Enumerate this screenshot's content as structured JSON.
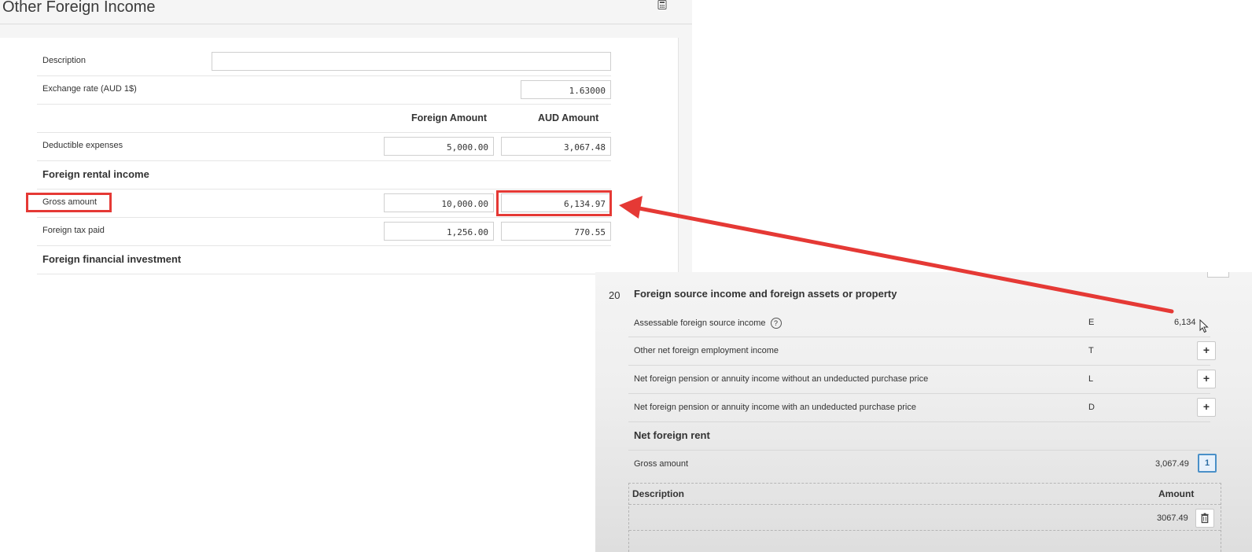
{
  "left_form": {
    "title": "Other Foreign Income",
    "calculator_icon": "calculator-icon",
    "description": {
      "label": "Description",
      "value": ""
    },
    "exchange_rate": {
      "label": "Exchange rate (AUD 1$)",
      "value": "1.63000"
    },
    "columns": {
      "foreign": "Foreign Amount",
      "aud": "AUD Amount"
    },
    "deductible_expenses": {
      "label": "Deductible expenses",
      "foreign": "5,000.00",
      "aud": "3,067.48"
    },
    "rental_section": "Foreign rental income",
    "gross_amount": {
      "label": "Gross amount",
      "foreign": "10,000.00",
      "aud": "6,134.97"
    },
    "foreign_tax_paid": {
      "label": "Foreign tax paid",
      "foreign": "1,256.00",
      "aud": "770.55"
    },
    "investment_section": "Foreign financial investment"
  },
  "right_form": {
    "question_number": "20",
    "question_title": "Foreign source income and foreign assets or property",
    "rows": [
      {
        "label": "Assessable foreign source income",
        "code": "E",
        "value": "6,134"
      },
      {
        "label": "Other net foreign employment income",
        "code": "T"
      },
      {
        "label": "Net foreign pension or annuity income without an undeducted purchase price",
        "code": "L"
      },
      {
        "label": "Net foreign pension or annuity income with an undeducted purchase price",
        "code": "D"
      }
    ],
    "add_label": "+",
    "help_glyph": "?",
    "rent_section": "Net foreign rent",
    "gross": {
      "label": "Gross amount",
      "value": "3,067.49",
      "badge": "1"
    },
    "detail_table": {
      "headers": {
        "description": "Description",
        "amount": "Amount"
      },
      "rows": [
        {
          "description": "",
          "amount": "3067.49"
        }
      ]
    }
  },
  "colors": {
    "highlight": "#e53935",
    "badge": "#4a90c8"
  }
}
